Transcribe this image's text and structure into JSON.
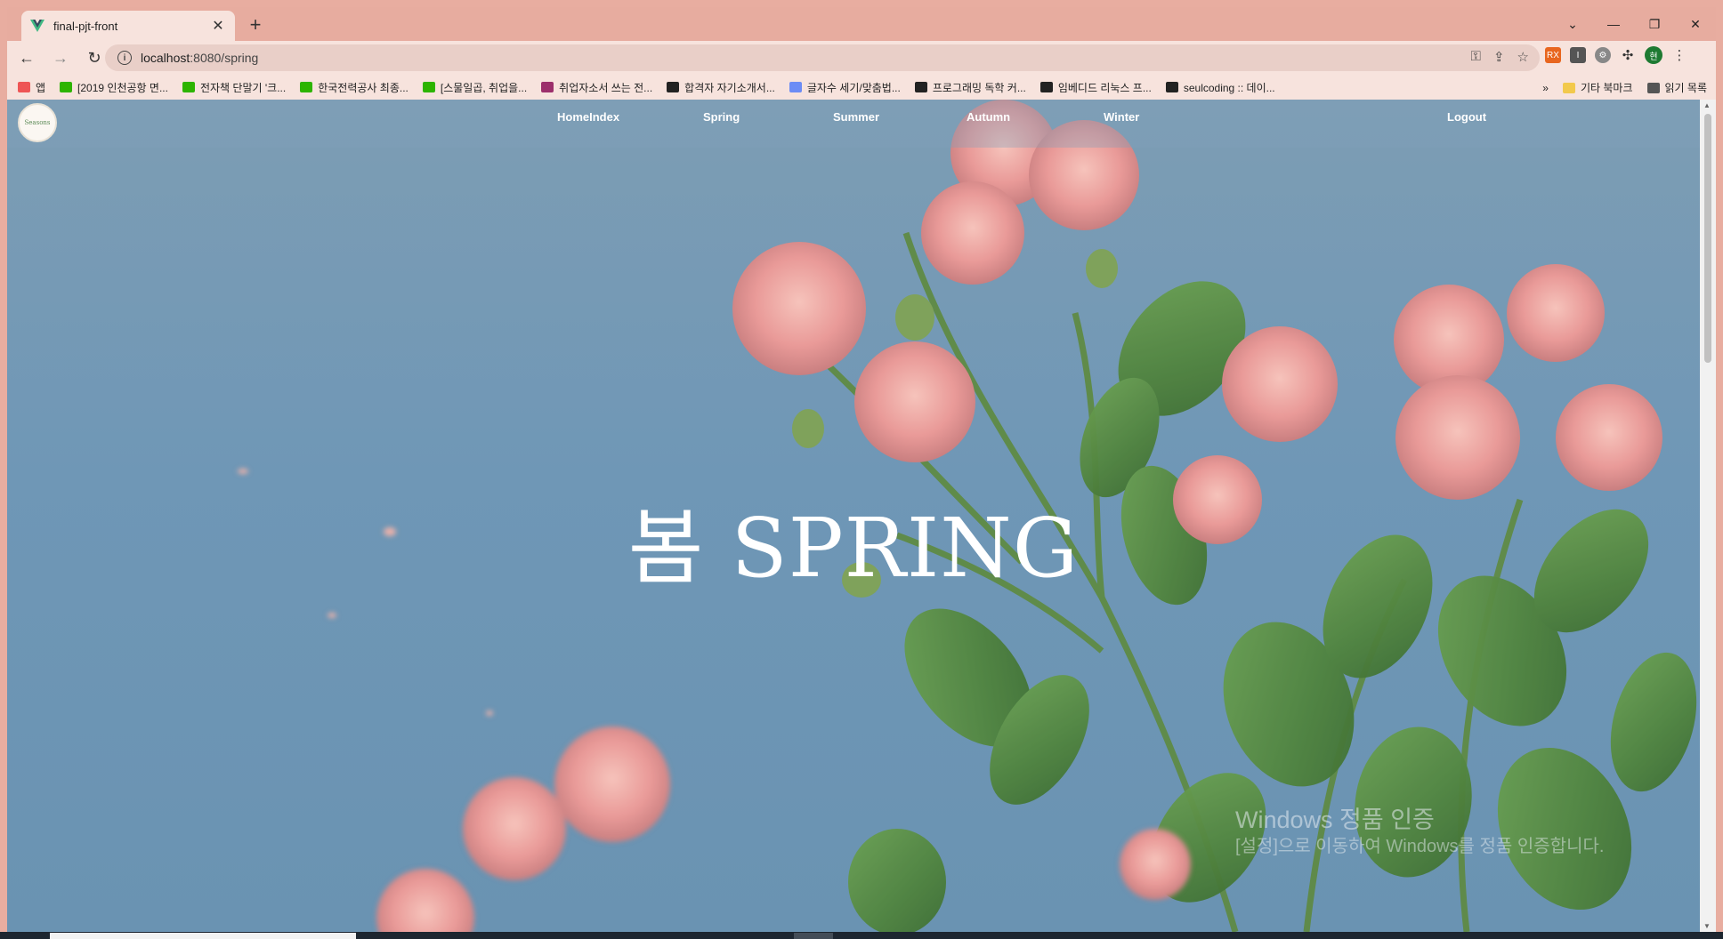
{
  "browser": {
    "tab_title": "final-pjt-front",
    "url_host": "localhost",
    "url_rest": ":8080/spring",
    "bookmarks": [
      {
        "label": "앱",
        "color": "#e55"
      },
      {
        "label": "[2019 인천공항 면...",
        "color": "#2db400"
      },
      {
        "label": "전자책 단말기 '크...",
        "color": "#2db400"
      },
      {
        "label": "한국전력공사 최종...",
        "color": "#2db400"
      },
      {
        "label": "[스물일곱, 취업을...",
        "color": "#2db400"
      },
      {
        "label": "취업자소서 쓰는 전...",
        "color": "#9c2f6b"
      },
      {
        "label": "합격자 자기소개서...",
        "color": "#222"
      },
      {
        "label": "글자수 세기/맞춤법...",
        "color": "#6c8cf5"
      },
      {
        "label": "프로그래밍 독학 커...",
        "color": "#222"
      },
      {
        "label": "임베디드 리눅스 프...",
        "color": "#222"
      },
      {
        "label": "seulcoding :: 데이...",
        "color": "#222"
      }
    ],
    "more_bookmarks": "»",
    "other_bookmarks": "기타 북마크",
    "reading_list": "읽기 목록",
    "profile_initial": "현"
  },
  "page": {
    "logo_text": "Seasons",
    "nav": {
      "home": "HomeIndex",
      "spring": "Spring",
      "summer": "Summer",
      "autumn": "Autumn",
      "winter": "Winter",
      "logout": "Logout"
    },
    "hero_title": "봄 SPRING"
  },
  "windows_watermark": {
    "line1": "Windows 정품 인증",
    "line2": "[설정]으로 이동하여 Windows를 정품 인증합니다."
  }
}
